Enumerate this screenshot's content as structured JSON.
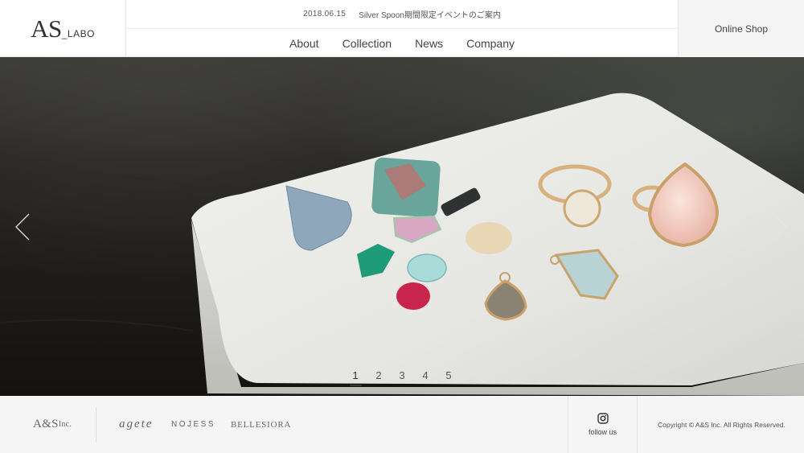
{
  "header": {
    "logo_main": "AS",
    "logo_sub": "_LABO",
    "news_date": "2018.06.15",
    "news_title": "Silver Spoon期間限定イベントのご案内",
    "nav": [
      "About",
      "Collection",
      "News",
      "Company"
    ],
    "online_shop": "Online Shop"
  },
  "hero": {
    "slides": [
      "1",
      "2",
      "3",
      "4",
      "5"
    ],
    "active_slide": 1
  },
  "footer": {
    "brand_as_main": "A&S",
    "brand_as_inc": "Inc.",
    "brand_agete": "agete",
    "brand_nojess": "NOJESS",
    "brand_bellesiora": "BELLESIORA",
    "instagram_icon": "instagram-icon",
    "follow_us": "follow us",
    "copyright": "Copyright © A&S Inc. All Rights Reserved."
  },
  "colors": {
    "text": "#333333",
    "footer_bg": "#f5f5f5",
    "shop_bg": "#f5f5f5"
  }
}
